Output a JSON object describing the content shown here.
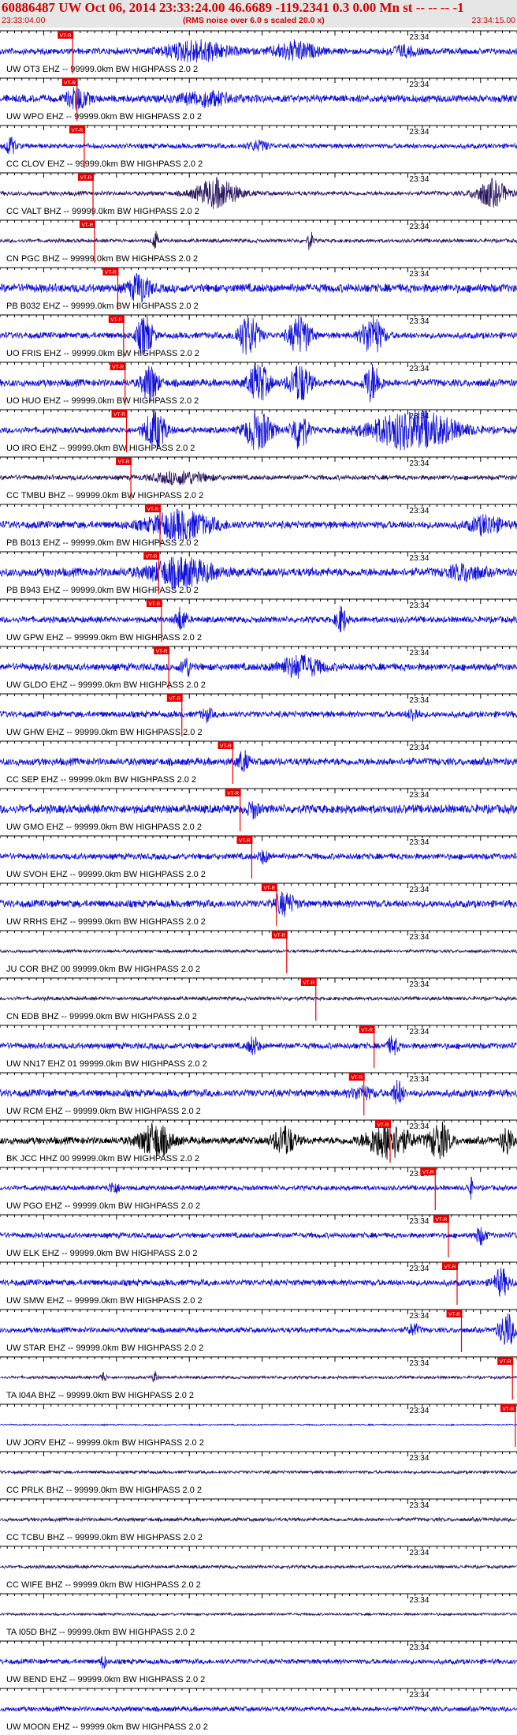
{
  "header": {
    "title": "60886487 UW Oct 06, 2014 23:33:24.00   46.6689 -119.2341  0.3 0.00 Mn st -- -- --  -1",
    "start_time": "23:33:04.00",
    "note": "(RMS noise over 6.0 s scaled 20.0 x)",
    "end_time": "23:34:15.00"
  },
  "colors": {
    "header_bg": "#e6e6e6",
    "header_text": "#d40000",
    "trace_blue": "#1010d8",
    "trace_navy": "#2a1660",
    "trace_black": "#000000",
    "pick": "#e80000"
  },
  "chart_data": {
    "type": "line",
    "xlabel": "",
    "ylabel": "",
    "tick_label": "23:34",
    "pick_label": "VT-R",
    "xlim": [
      "23:33:04.00",
      "23:34:15.00"
    ],
    "grid": false,
    "legend": "none",
    "series": [
      {
        "name": "UW OT3 EHZ -- 99999.0km BW  HIGHPASS  2.0  2",
        "color": "blue",
        "pick_time": "23:33:13.0",
        "noise": 0.25,
        "bursts": [
          [
            0.38,
            0.06,
            0.7
          ],
          [
            0.57,
            0.04,
            0.6
          ],
          [
            0.78,
            0.03,
            0.3
          ]
        ]
      },
      {
        "name": "UW WPO EHZ -- 99999.0km BW  HIGHPASS  2.0  2",
        "color": "blue",
        "pick_time": "23:33:13.6",
        "noise": 0.3,
        "bursts": [
          [
            0.15,
            0.02,
            0.7
          ],
          [
            0.4,
            0.05,
            0.4
          ]
        ]
      },
      {
        "name": "CC CLOV EHZ -- 99999.0km BW  HIGHPASS  2.0  2",
        "color": "blue",
        "pick_time": "23:33:14.6",
        "noise": 0.2,
        "bursts": [
          [
            0.02,
            0.01,
            0.6
          ],
          [
            0.5,
            0.02,
            0.3
          ]
        ]
      },
      {
        "name": "CC VALT BHZ -- 99999.0km BW  HIGHPASS  2.0  2",
        "color": "navy",
        "pick_time": "23:33:15.8",
        "noise": 0.18,
        "bursts": [
          [
            0.42,
            0.04,
            1.0
          ],
          [
            0.95,
            0.03,
            0.9
          ]
        ]
      },
      {
        "name": "CN PGC BHZ -- 99999.0km BW  HIGHPASS  2.0  2",
        "color": "navy",
        "pick_time": "23:33:16.0",
        "noise": 0.15,
        "bursts": [
          [
            0.3,
            0.005,
            0.7
          ],
          [
            0.6,
            0.005,
            0.7
          ]
        ]
      },
      {
        "name": "PB B032 EHZ -- 99999.0km BW  HIGHPASS  2.0  2",
        "color": "blue",
        "pick_time": "23:33:19.2",
        "noise": 0.35,
        "bursts": [
          [
            0.27,
            0.02,
            0.9
          ]
        ]
      },
      {
        "name": "UO FRIS EHZ -- 99999.0km BW  HIGHPASS  2.0  2",
        "color": "blue",
        "pick_time": "23:33:20.0",
        "noise": 0.25,
        "bursts": [
          [
            0.28,
            0.015,
            1.4
          ],
          [
            0.48,
            0.02,
            1.4
          ],
          [
            0.58,
            0.02,
            1.4
          ],
          [
            0.72,
            0.02,
            1.4
          ]
        ]
      },
      {
        "name": "UO HUO EHZ -- 99999.0km BW  HIGHPASS  2.0  2",
        "color": "blue",
        "pick_time": "23:33:20.2",
        "noise": 0.3,
        "bursts": [
          [
            0.29,
            0.015,
            1.3
          ],
          [
            0.5,
            0.02,
            1.3
          ],
          [
            0.58,
            0.02,
            1.3
          ],
          [
            0.72,
            0.015,
            1.3
          ]
        ]
      },
      {
        "name": "UO IRO EHZ -- 99999.0km BW  HIGHPASS  2.0  2",
        "color": "blue",
        "pick_time": "23:33:20.4",
        "noise": 0.25,
        "bursts": [
          [
            0.3,
            0.02,
            1.4
          ],
          [
            0.5,
            0.025,
            1.4
          ],
          [
            0.58,
            0.015,
            1.4
          ],
          [
            0.8,
            0.08,
            1.4
          ]
        ]
      },
      {
        "name": "CC TMBU BHZ -- 99999.0km BW  HIGHPASS  2.0  2",
        "color": "navy",
        "pick_time": "23:33:21.0",
        "noise": 0.2,
        "bursts": [
          [
            0.35,
            0.05,
            0.4
          ]
        ]
      },
      {
        "name": "PB B013 EHZ -- 99999.0km BW  HIGHPASS  2.0  2",
        "color": "blue",
        "pick_time": "23:33:25.0",
        "noise": 0.3,
        "bursts": [
          [
            0.35,
            0.06,
            0.9
          ],
          [
            0.94,
            0.03,
            0.6
          ]
        ]
      },
      {
        "name": "PB B943 EHZ -- 99999.0km BW  HIGHPASS  2.0  2",
        "color": "blue",
        "pick_time": "23:33:24.8",
        "noise": 0.35,
        "bursts": [
          [
            0.35,
            0.06,
            0.9
          ],
          [
            0.9,
            0.03,
            0.5
          ]
        ]
      },
      {
        "name": "UW GPW EHZ -- 99999.0km BW  HIGHPASS  2.0  2",
        "color": "blue",
        "pick_time": "23:33:25.2",
        "noise": 0.25,
        "bursts": [
          [
            0.35,
            0.01,
            0.8
          ],
          [
            0.66,
            0.01,
            0.9
          ]
        ]
      },
      {
        "name": "UW GLDO EHZ -- 99999.0km BW  HIGHPASS  2.0  2",
        "color": "blue",
        "pick_time": "23:33:26.2",
        "noise": 0.3,
        "bursts": [
          [
            0.36,
            0.01,
            0.6
          ],
          [
            0.58,
            0.04,
            0.7
          ]
        ]
      },
      {
        "name": "UW GHW EHZ -- 99999.0km BW  HIGHPASS  2.0  2",
        "color": "blue",
        "pick_time": "23:33:28.0",
        "noise": 0.25,
        "bursts": [
          [
            0.4,
            0.01,
            0.4
          ],
          [
            0.8,
            0.01,
            0.4
          ]
        ]
      },
      {
        "name": "CC SEP EHZ -- 99999.0km BW  HIGHPASS  2.0  2",
        "color": "blue",
        "pick_time": "23:33:35.0",
        "noise": 0.3,
        "bursts": [
          [
            0.47,
            0.01,
            0.7
          ]
        ]
      },
      {
        "name": "UW GMO EHZ -- 99999.0km BW  HIGHPASS  2.0  2",
        "color": "blue",
        "pick_time": "23:33:36.0",
        "noise": 0.35,
        "bursts": [
          [
            0.49,
            0.01,
            0.5
          ]
        ]
      },
      {
        "name": "UW SVOH EHZ -- 99999.0km BW  HIGHPASS  2.0  2",
        "color": "blue",
        "pick_time": "23:33:37.6",
        "noise": 0.25,
        "bursts": [
          [
            0.51,
            0.01,
            0.4
          ]
        ]
      },
      {
        "name": "UW RRHS EHZ -- 99999.0km BW  HIGHPASS  2.0  2",
        "color": "blue",
        "pick_time": "23:33:41.0",
        "noise": 0.3,
        "bursts": [
          [
            0.55,
            0.02,
            0.7
          ]
        ]
      },
      {
        "name": "JU COR BHZ 00 99999.0km BW  HIGHPASS  2.0  2",
        "color": "navy",
        "pick_time": "23:33:42.4",
        "noise": 0.12,
        "bursts": []
      },
      {
        "name": "CN EDB BHZ -- 99999.0km BW  HIGHPASS  2.0  2",
        "color": "navy",
        "pick_time": "23:33:46.4",
        "noise": 0.15,
        "bursts": []
      },
      {
        "name": "UW NN17 EHZ 01 99999.0km BW  HIGHPASS  2.0  2",
        "color": "blue",
        "pick_time": "23:33:54.4",
        "noise": 0.25,
        "bursts": [
          [
            0.49,
            0.01,
            0.6
          ],
          [
            0.76,
            0.01,
            0.6
          ]
        ]
      },
      {
        "name": "UW RCM EHZ -- 99999.0km BW  HIGHPASS  2.0  2",
        "color": "blue",
        "pick_time": "23:33:53.0",
        "noise": 0.3,
        "bursts": [
          [
            0.7,
            0.02,
            0.4
          ],
          [
            0.77,
            0.01,
            0.8
          ]
        ]
      },
      {
        "name": "BK JCC HHZ 00 99999.0km BW  HIGHPASS  2.0  2",
        "color": "black",
        "pick_time": "23:33:56.6",
        "noise": 0.3,
        "bursts": [
          [
            0.3,
            0.03,
            1.1
          ],
          [
            0.55,
            0.02,
            1.0
          ],
          [
            0.75,
            0.04,
            1.2
          ],
          [
            0.85,
            0.02,
            1.2
          ],
          [
            0.98,
            0.01,
            1.0
          ]
        ]
      },
      {
        "name": "UW PGO EHZ -- 99999.0km BW  HIGHPASS  2.0  2",
        "color": "blue",
        "pick_time": "23:34:02.8",
        "noise": 0.2,
        "bursts": [
          [
            0.22,
            0.01,
            0.4
          ],
          [
            0.91,
            0.005,
            0.7
          ]
        ]
      },
      {
        "name": "UW ELK EHZ -- 99999.0km BW  HIGHPASS  2.0  2",
        "color": "blue",
        "pick_time": "23:34:04.6",
        "noise": 0.22,
        "bursts": [
          [
            0.93,
            0.01,
            0.6
          ]
        ]
      },
      {
        "name": "UW SMW EHZ -- 99999.0km BW  HIGHPASS  2.0  2",
        "color": "blue",
        "pick_time": "23:34:05.8",
        "noise": 0.25,
        "bursts": [
          [
            0.97,
            0.015,
            0.9
          ]
        ]
      },
      {
        "name": "UW STAR EHZ -- 99999.0km BW  HIGHPASS  2.0  2",
        "color": "blue",
        "pick_time": "23:34:06.4",
        "noise": 0.22,
        "bursts": [
          [
            0.8,
            0.01,
            0.4
          ],
          [
            0.98,
            0.015,
            1.2
          ]
        ]
      },
      {
        "name": "TA I04A BHZ -- 99999.0km BW  HIGHPASS  2.0  2",
        "color": "navy",
        "pick_time": "23:34:13.4",
        "noise": 0.12,
        "bursts": [
          [
            0.2,
            0.005,
            0.4
          ],
          [
            0.3,
            0.005,
            0.4
          ]
        ]
      },
      {
        "name": "UW JORV EHZ -- 99999.0km BW  HIGHPASS  2.0  2",
        "color": "blue",
        "pick_time": "23:34:13.8",
        "noise": 0.05,
        "bursts": []
      },
      {
        "name": "CC PRLK BHZ -- 99999.0km BW  HIGHPASS  2.0  2",
        "color": "navy",
        "pick_time": null,
        "noise": 0.12,
        "bursts": []
      },
      {
        "name": "CC TCBU BHZ -- 99999.0km BW  HIGHPASS  2.0  2",
        "color": "navy",
        "pick_time": null,
        "noise": 0.15,
        "bursts": []
      },
      {
        "name": "CC WIFE BHZ -- 99999.0km BW  HIGHPASS  2.0  2",
        "color": "navy",
        "pick_time": null,
        "noise": 0.13,
        "bursts": []
      },
      {
        "name": "TA I05D BHZ -- 99999.0km BW  HIGHPASS  2.0  2",
        "color": "navy",
        "pick_time": null,
        "noise": 0.1,
        "bursts": []
      },
      {
        "name": "UW BEND EHZ -- 99999.0km BW  HIGHPASS  2.0  2",
        "color": "blue",
        "pick_time": null,
        "noise": 0.2,
        "bursts": [
          [
            0.2,
            0.005,
            0.5
          ]
        ]
      },
      {
        "name": "UW MOON EHZ -- 99999.0km BW  HIGHPASS  2.0  2",
        "color": "blue",
        "pick_time": null,
        "noise": 0.2,
        "bursts": []
      }
    ]
  }
}
